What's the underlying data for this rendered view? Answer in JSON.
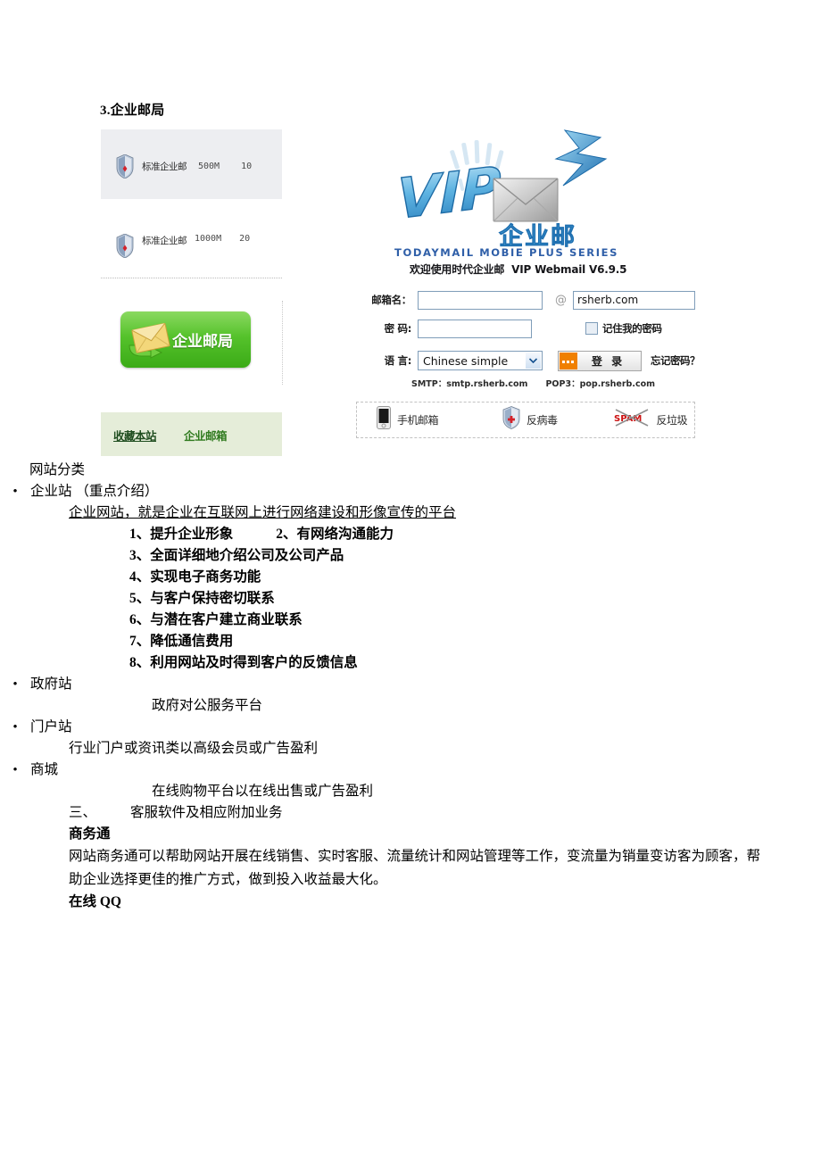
{
  "document": {
    "heading": "3.企业邮局"
  },
  "mail_products": {
    "rows": [
      {
        "icon": "shield-icon",
        "name": "标准企业邮",
        "size": "500M",
        "count": "10"
      },
      {
        "icon": "shield-icon",
        "name": "标准企业邮",
        "size": "1000M",
        "count": "20"
      }
    ],
    "button_label": "企业邮局",
    "button_icon": "envelope-arrow-icon",
    "links": [
      {
        "label": "收藏本站"
      },
      {
        "label": "企业邮箱"
      }
    ]
  },
  "webmail": {
    "logo_text": "VIP",
    "logo_subtext": "企业邮",
    "logo_icon": "envelope-lightning-icon",
    "series_text": "TODAYMAIL MOBIE PLUS SERIES",
    "welcome_text": "欢迎使用时代企业邮",
    "version_text": "VIP Webmail V6.9.5",
    "form": {
      "account_label": "邮箱名：",
      "account_value": "",
      "at_symbol": "@",
      "domain_value": "rsherb.com",
      "password_label": "密 码:",
      "password_value": "",
      "remember_label": "记住我的密码",
      "language_label": "语 言:",
      "language_value": "Chinese simple",
      "language_options": [
        "Chinese simple"
      ],
      "login_label": "登 录",
      "forgot_label": "忘记密码？"
    },
    "server_smtp": "SMTP：smtp.rsherb.com",
    "server_pop3": "POP3：pop.rsherb.com",
    "features": [
      {
        "icon": "mobile-phone-icon",
        "label": "手机邮箱"
      },
      {
        "icon": "shield-antivirus-icon",
        "label": "反病毒"
      },
      {
        "icon": "spam-blocked-icon",
        "label": "反垃圾"
      }
    ]
  },
  "content": {
    "section_title": "网站分类",
    "bullets": [
      {
        "label": "企业站 （重点介绍）",
        "description": "企业网站，就是企业在互联网上进行网络建设和形像宣传的平台",
        "items": [
          "1、提升企业形象",
          "2、有网络沟通能力",
          "3、全面详细地介绍公司及公司产品",
          "4、实现电子商务功能",
          "5、与客户保持密切联系",
          "6、与潜在客户建立商业联系",
          "7、降低通信费用",
          "8、利用网站及时得到客户的反馈信息"
        ]
      },
      {
        "label": "政府站",
        "description": "政府对公服务平台",
        "items": []
      },
      {
        "label": "门户站",
        "description": "行业门户或资讯类以高级会员或广告盈利",
        "items": []
      },
      {
        "label": "商城",
        "description": "在线购物平台以在线出售或广告盈利",
        "items": []
      }
    ],
    "section_three_number": "三、",
    "section_three_title": "客服软件及相应附加业务",
    "subsection_title": "商务通",
    "paragraph": "网站商务通可以帮助网站开展在线销售、实时客服、流量统计和网站管理等工作，变流量为销量变访客为顾客，帮助企业选择更佳的推广方式，做到投入收益最大化。",
    "last_line": "在线 QQ"
  },
  "colors": {
    "brand_blue": "#2f5fa8",
    "button_green": "#55c22b",
    "links_bar_bg": "#e5edd9",
    "panel_gray": "#edeef1",
    "input_border": "#7f9db9",
    "login_orange": "#f08000",
    "spam_red": "#cc1111"
  }
}
